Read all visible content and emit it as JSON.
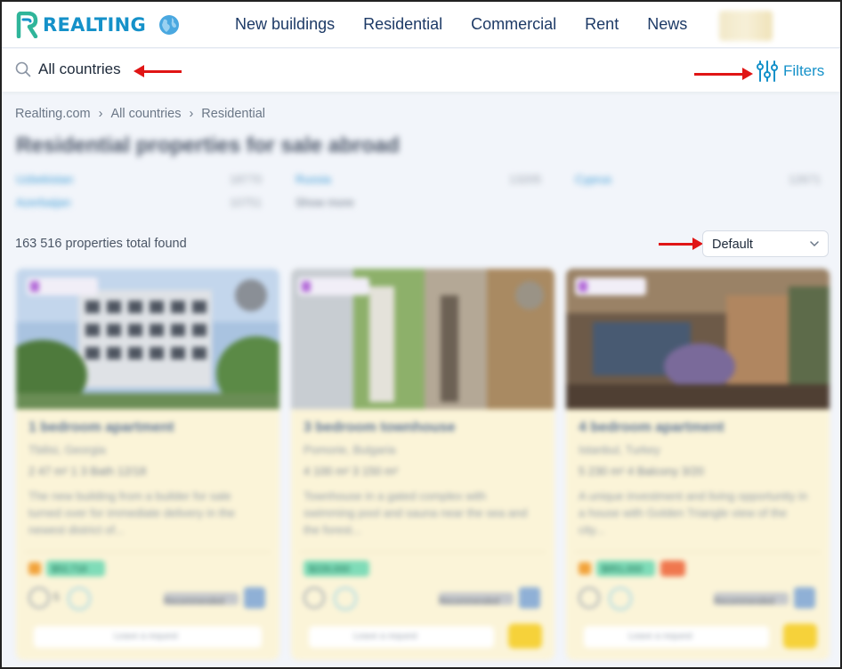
{
  "header": {
    "logo_text": "REALTING",
    "nav": [
      "New buildings",
      "Residential",
      "Commercial",
      "Rent",
      "News"
    ],
    "brand_color": "#1591c9"
  },
  "search": {
    "value": "All countries",
    "filters_label": "Filters"
  },
  "breadcrumb": [
    "Realting.com",
    "All countries",
    "Residential"
  ],
  "page_title": "Residential properties for sale abroad",
  "facets": [
    {
      "name": "Uzbekistan",
      "count": "18770"
    },
    {
      "name": "Russia",
      "count": "13205"
    },
    {
      "name": "Cyprus",
      "count": "12671"
    },
    {
      "name": "Azerbaijan",
      "count": "10751"
    },
    {
      "name": "Show more",
      "count": ""
    }
  ],
  "results": {
    "total_text": "163 516 properties total found",
    "sort_value": "Default"
  },
  "cards": [
    {
      "title": "1 bedroom apartment",
      "location": "Tbilisi, Georgia",
      "specs": "2  47 m²  1  3 Bath  12/18",
      "description": "The new building from a builder for sale turned over for immediate delivery in the newest district of...",
      "price": "$52,716",
      "hot": false,
      "likes": "5",
      "agency": "Recommended",
      "contact": "Leave a request"
    },
    {
      "title": "3 bedroom townhouse",
      "location": "Pomorie, Bulgaria",
      "specs": "4  100 m²  3  150 m²",
      "description": "Townhouse in a gated complex with swimming pool and sauna near the sea and the forest...",
      "price": "$226,000",
      "hot": false,
      "likes": "",
      "agency": "Recommended",
      "contact": "Leave a request"
    },
    {
      "title": "4 bedroom apartment",
      "location": "Istanbul, Turkey",
      "specs": "5  230 m²  4  Balcony  3/20",
      "description": "A unique investment and living opportunity in a house with Golden Triangle view of the city...",
      "price": "$951,000",
      "hot": true,
      "likes": "",
      "agency": "Recommended",
      "contact": "Leave a request"
    }
  ]
}
